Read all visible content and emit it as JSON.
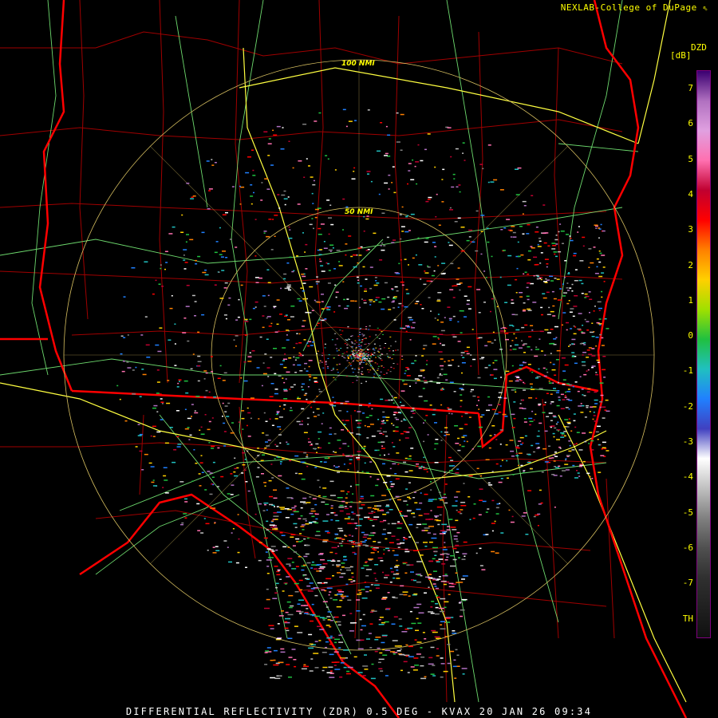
{
  "credit": "NEXLAB-College of DuPage",
  "colorbar": {
    "product": "DZD",
    "units": "[dB]",
    "ticks": [
      "7",
      "6",
      "5",
      "4",
      "3",
      "2",
      "1",
      "0",
      "-1",
      "-2",
      "-3",
      "-4",
      "-5",
      "-6",
      "-7",
      "TH"
    ],
    "colors": [
      "#3a0070",
      "#b070c0",
      "#e0a0e0",
      "#ff70b0",
      "#c00030",
      "#ff0000",
      "#ff8000",
      "#ffd000",
      "#a0e000",
      "#20c040",
      "#20c0c0",
      "#2080ff",
      "#4040c0",
      "#ffffff",
      "#c0c0c0",
      "#808080",
      "#505050",
      "#303030",
      "#202020",
      "#101010"
    ]
  },
  "rings": [
    {
      "label": "100 NMI"
    },
    {
      "label": "50 NMI"
    }
  ],
  "footer": "DIFFERENTIAL REFLECTIVITY (ZDR) 0.5 DEG - KVAX 20 JAN 26 09:34",
  "map_colors": {
    "state_lines": "#ff0000",
    "county_lines": "#a00000",
    "highways": "#80ff80",
    "interstates": "#ffff40",
    "rings": "#d8c060"
  }
}
